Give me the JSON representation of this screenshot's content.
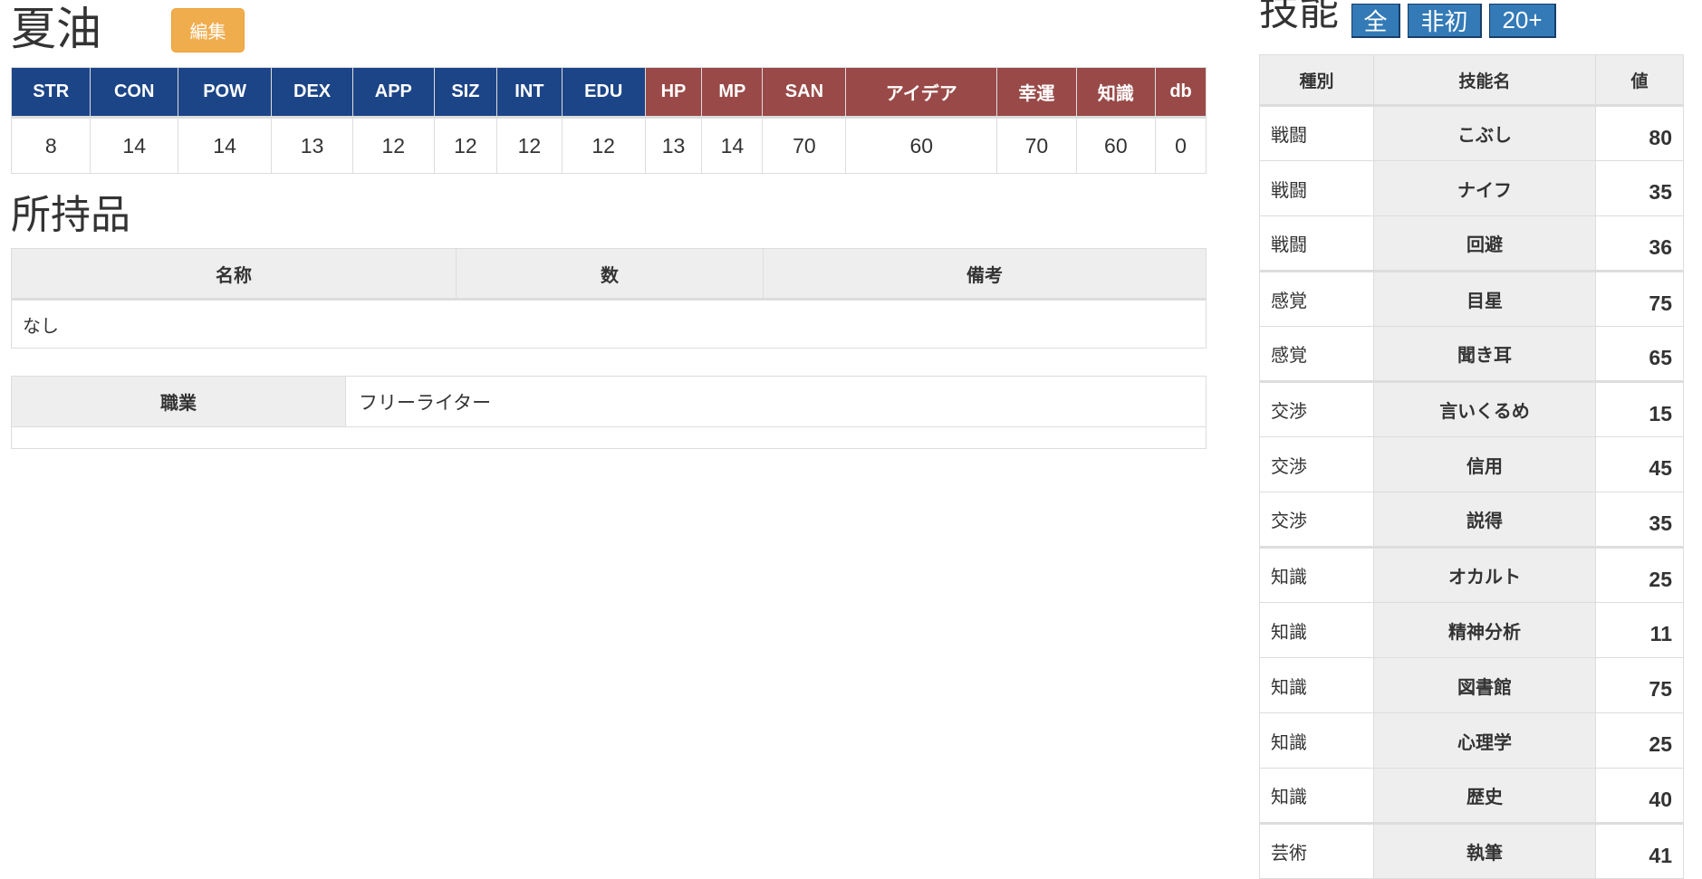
{
  "character": {
    "name": "夏油",
    "edit_label": "編集"
  },
  "stats": {
    "headers": [
      "STR",
      "CON",
      "POW",
      "DEX",
      "APP",
      "SIZ",
      "INT",
      "EDU",
      "HP",
      "MP",
      "SAN",
      "アイデア",
      "幸運",
      "知識",
      "db"
    ],
    "values": [
      "8",
      "14",
      "14",
      "13",
      "12",
      "12",
      "12",
      "12",
      "13",
      "14",
      "70",
      "60",
      "70",
      "60",
      "0"
    ],
    "colors": {
      "base": "#1c4587",
      "derived": "#994a48"
    }
  },
  "items": {
    "title": "所持品",
    "headers": [
      "名称",
      "数",
      "備考"
    ],
    "empty_text": "なし"
  },
  "job": {
    "label": "職業",
    "value": "フリーライター"
  },
  "skills": {
    "title": "技能",
    "filters": [
      "全",
      "非初",
      "20+"
    ],
    "headers": [
      "種別",
      "技能名",
      "値"
    ],
    "rows": [
      {
        "cat": "戦闘",
        "name": "こぶし",
        "value": "80"
      },
      {
        "cat": "戦闘",
        "name": "ナイフ",
        "value": "35"
      },
      {
        "cat": "戦闘",
        "name": "回避",
        "value": "36"
      },
      {
        "cat": "感覚",
        "name": "目星",
        "value": "75"
      },
      {
        "cat": "感覚",
        "name": "聞き耳",
        "value": "65"
      },
      {
        "cat": "交渉",
        "name": "言いくるめ",
        "value": "15"
      },
      {
        "cat": "交渉",
        "name": "信用",
        "value": "45"
      },
      {
        "cat": "交渉",
        "name": "説得",
        "value": "35"
      },
      {
        "cat": "知識",
        "name": "オカルト",
        "value": "25"
      },
      {
        "cat": "知識",
        "name": "精神分析",
        "value": "11"
      },
      {
        "cat": "知識",
        "name": "図書館",
        "value": "75"
      },
      {
        "cat": "知識",
        "name": "心理学",
        "value": "25"
      },
      {
        "cat": "知識",
        "name": "歴史",
        "value": "40"
      },
      {
        "cat": "芸術",
        "name": "執筆",
        "value": "41"
      }
    ]
  }
}
